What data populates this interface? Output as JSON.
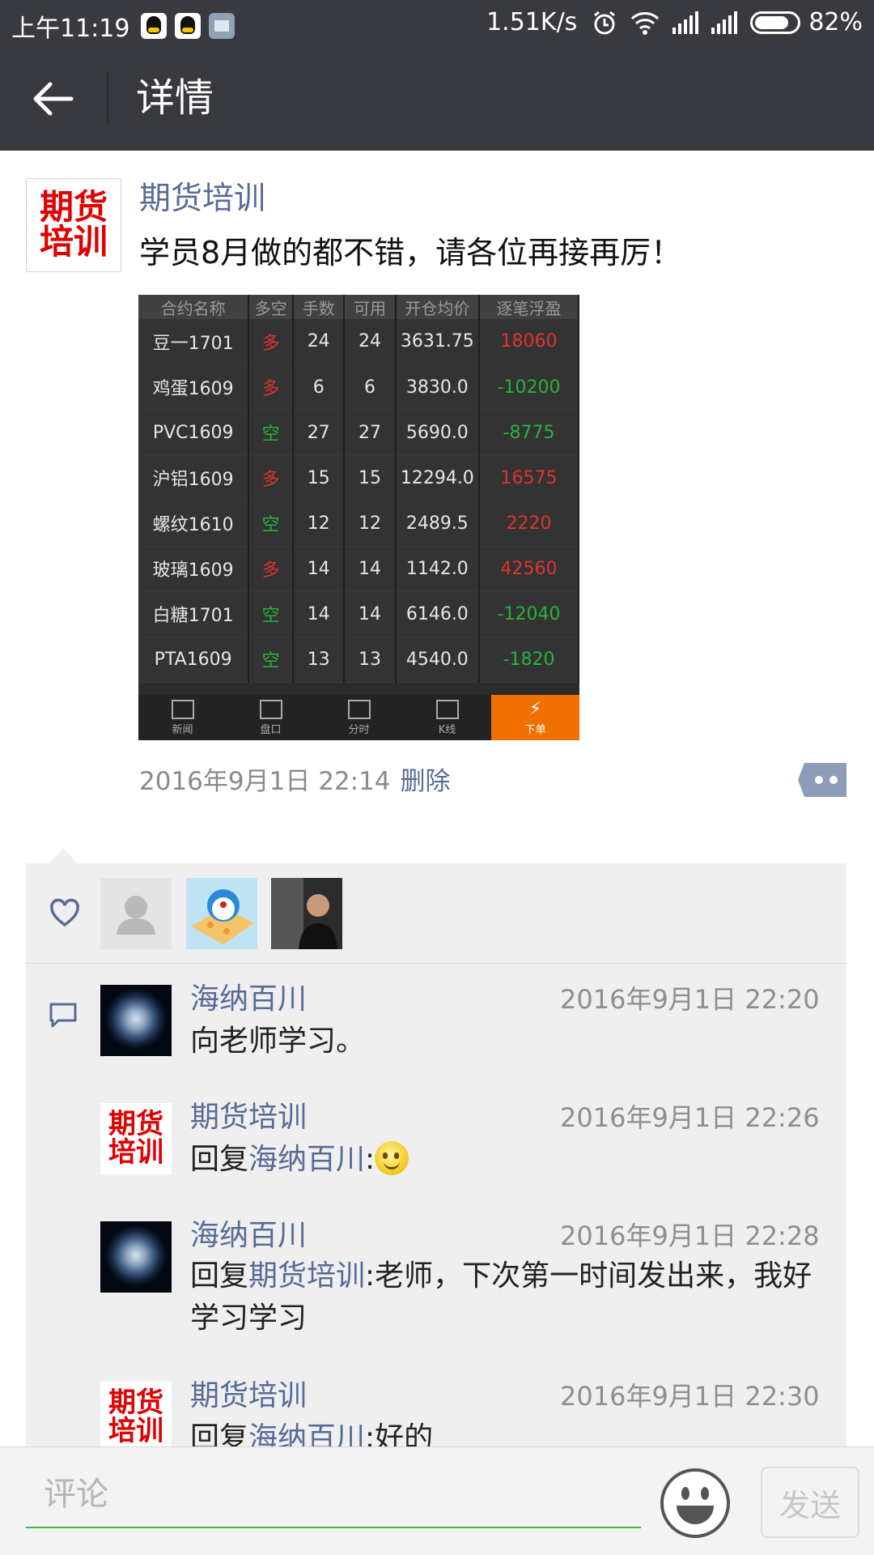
{
  "status_bar": {
    "time": "上午11:19",
    "speed": "1.51K/s",
    "battery": "82%",
    "battery_level": 0.82
  },
  "header": {
    "title": "详情"
  },
  "post": {
    "author": "期货培训",
    "logo_text_line1": "期货",
    "logo_text_line2": "培训",
    "text": "学员8月做的都不错，请各位再接再厉！",
    "time": "2016年9月1日 22:14",
    "delete_label": "删除"
  },
  "stock_table": {
    "columns": [
      "合约名称",
      "多空",
      "手数",
      "可用",
      "开仓均价",
      "逐笔浮盈"
    ],
    "rows": [
      {
        "name": "豆一1701",
        "dir": "多",
        "qty": "24",
        "avail": "24",
        "price": "3631.75",
        "pl": "18060"
      },
      {
        "name": "鸡蛋1609",
        "dir": "多",
        "qty": "6",
        "avail": "6",
        "price": "3830.0",
        "pl": "-10200"
      },
      {
        "name": "PVC1609",
        "dir": "空",
        "qty": "27",
        "avail": "27",
        "price": "5690.0",
        "pl": "-8775"
      },
      {
        "name": "沪铝1609",
        "dir": "多",
        "qty": "15",
        "avail": "15",
        "price": "12294.0",
        "pl": "16575"
      },
      {
        "name": "螺纹1610",
        "dir": "空",
        "qty": "12",
        "avail": "12",
        "price": "2489.5",
        "pl": "2220"
      },
      {
        "name": "玻璃1609",
        "dir": "多",
        "qty": "14",
        "avail": "14",
        "price": "1142.0",
        "pl": "42560"
      },
      {
        "name": "白糖1701",
        "dir": "空",
        "qty": "14",
        "avail": "14",
        "price": "6146.0",
        "pl": "-12040"
      },
      {
        "name": "PTA1609",
        "dir": "空",
        "qty": "13",
        "avail": "13",
        "price": "4540.0",
        "pl": "-1820"
      }
    ],
    "tabs": [
      "新闻",
      "盘口",
      "分时",
      "K线",
      "下单"
    ],
    "colors": {
      "long": "#e0332e",
      "short": "#28b33e",
      "profit": "#e0332e",
      "loss": "#28b33e",
      "active_tab": "#f07000"
    }
  },
  "comments": [
    {
      "author": "海纳百川",
      "time": "2016年9月1日 22:20",
      "text": "向老师学习。"
    },
    {
      "author": "期货培训",
      "time": "2016年9月1日 22:26",
      "prefix": "回复",
      "reply_to": "海纳百川",
      "after": ":"
    },
    {
      "author": "海纳百川",
      "time": "2016年9月1日 22:28",
      "prefix": "回复",
      "reply_to": "期货培训",
      "after": ":老师，下次第一时间发出来，我好学习学习"
    },
    {
      "author": "期货培训",
      "time": "2016年9月1日 22:30",
      "prefix": "回复",
      "reply_to": "海纳百川",
      "after": ":好的"
    }
  ],
  "input_bar": {
    "placeholder": "评论",
    "send_label": "发送"
  },
  "theme": {
    "link": "#576b95",
    "header_bg": "#393a3f",
    "accent_green": "#44b549"
  }
}
